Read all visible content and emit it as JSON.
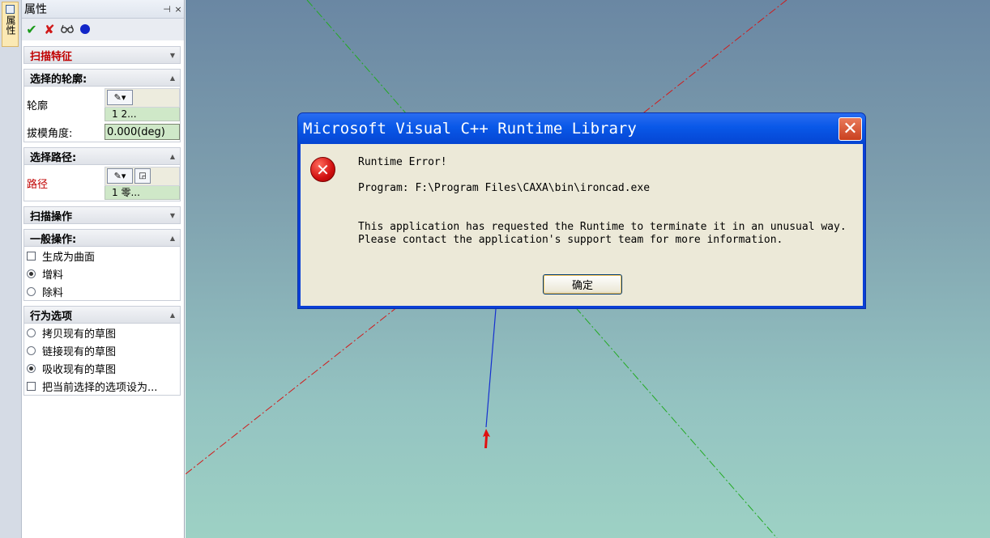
{
  "tab_strip": {
    "tab_label": "属性"
  },
  "panel": {
    "title": "属性",
    "title_buttons": [
      "⊣",
      "×"
    ],
    "toolbar": [
      "ok-check",
      "cancel-x",
      "preview-glasses",
      "blue-dot"
    ],
    "sections": {
      "sweep_feature": {
        "header": "扫描特征"
      },
      "profile": {
        "header": "选择的轮廓:",
        "label": "轮廓",
        "value": "1  2...",
        "angle_label": "拔模角度:",
        "angle_value": "0.000(deg)"
      },
      "path": {
        "header": "选择路径:",
        "label": "路径",
        "value": "1  零..."
      },
      "sweep_op": {
        "header": "扫描操作"
      },
      "general_ops": {
        "header": "一般操作:",
        "options": [
          {
            "label": "生成为曲面",
            "kind": "checkbox",
            "checked": false
          },
          {
            "label": "增料",
            "kind": "radio",
            "checked": true
          },
          {
            "label": "除料",
            "kind": "radio",
            "checked": false
          }
        ]
      },
      "behavior": {
        "header": "行为选项",
        "options": [
          {
            "label": "拷贝现有的草图",
            "kind": "radio",
            "checked": false
          },
          {
            "label": "链接现有的草图",
            "kind": "radio",
            "checked": false
          },
          {
            "label": "吸收现有的草图",
            "kind": "radio",
            "checked": true
          },
          {
            "label": "把当前选择的选项设为...",
            "kind": "checkbox",
            "checked": false
          }
        ]
      }
    }
  },
  "dialog": {
    "title": "Microsoft Visual C++ Runtime Library",
    "close_glyph": "✕",
    "error_glyph": "✕",
    "line1": "Runtime Error!",
    "line2": "Program: F:\\Program Files\\CAXA\\bin\\ironcad.exe",
    "line3": "This application has requested the Runtime to terminate it in an unusual way.",
    "line4": "Please contact the application's support team for more information.",
    "ok_label": "确定"
  },
  "colors": {
    "title_red": "#c00000",
    "dialog_blue": "#0a3fd6",
    "axis_red": "#d11a1a",
    "axis_green": "#22aa22",
    "axis_blue": "#1530d0"
  }
}
